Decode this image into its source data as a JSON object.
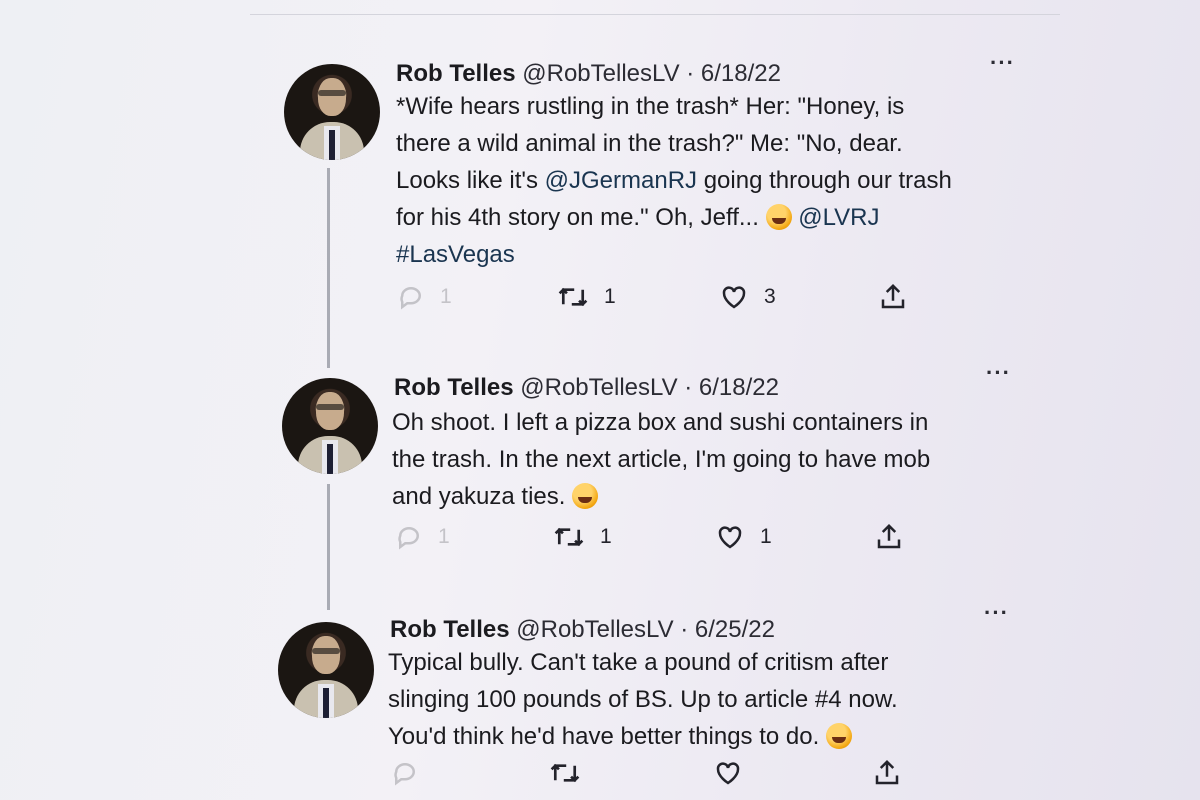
{
  "tweets": [
    {
      "name": "Rob Telles",
      "meta": "@RobTellesLV · 6/18/22",
      "more": "···",
      "text": {
        "l1": "*Wife hears rustling in the trash* Her: \"Honey, is",
        "l2": "there a wild animal in the trash?\" Me: \"No, dear.",
        "l3_pre": "Looks like it's ",
        "l3_mention": "@JGermanRJ",
        "l3_post": " going through our trash",
        "l4_pre": "for his 4th story on me.\" Oh, Jeff... ",
        "l4_mention": "@LVRJ",
        "l5_hashtag": "#LasVegas"
      },
      "emoji": "face-with-tears-of-joy",
      "counts": {
        "reply": "1",
        "retweet": "1",
        "like": "3"
      }
    },
    {
      "name": "Rob Telles",
      "meta": "@RobTellesLV · 6/18/22",
      "more": "···",
      "text": {
        "l1": "Oh shoot. I left a pizza box and sushi containers in",
        "l2": "the trash. In the next article, I'm going to have mob",
        "l3": "and yakuza ties. "
      },
      "emoji": "face-with-tears-of-joy",
      "counts": {
        "reply": "1",
        "retweet": "1",
        "like": "1"
      }
    },
    {
      "name": "Rob Telles",
      "meta": "@RobTellesLV · 6/25/22",
      "more": "···",
      "text": {
        "l1": "Typical bully. Can't take a pound of critism after",
        "l2": "slinging 100 pounds of BS. Up to article #4 now.",
        "l3": "You'd think he'd have better things to do. "
      },
      "emoji": "zany-face",
      "counts": {}
    }
  ],
  "icons": [
    "reply-icon",
    "retweet-icon",
    "like-icon",
    "share-icon",
    "more-icon"
  ]
}
